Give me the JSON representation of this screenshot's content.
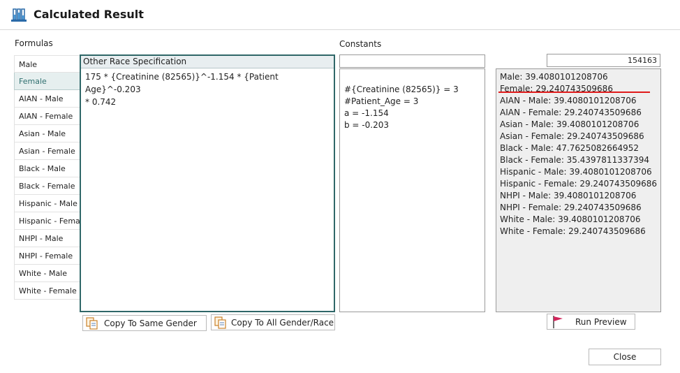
{
  "window": {
    "title": "Calculated Result"
  },
  "formulas": {
    "label": "Formulas",
    "items": [
      "Male",
      "Female",
      "AIAN - Male",
      "AIAN - Female",
      "Asian - Male",
      "Asian - Female",
      "Black - Male",
      "Black - Female",
      "Hispanic - Male",
      "Hispanic - Female",
      "NHPI - Male",
      "NHPI - Female",
      "White - Male",
      "White - Female"
    ],
    "selected": "Female"
  },
  "spec": {
    "header": "Other Race Specification",
    "formula": "175 * {Creatinine (82565)}^-1.154 * {Patient Age}^-0.203\n* 0.742"
  },
  "buttons": {
    "copy_same_gender": "Copy To Same Gender",
    "copy_all": "Copy To All Gender/Race",
    "run_preview": "Run Preview",
    "close": "Close"
  },
  "constants": {
    "label": "Constants",
    "input_value": "",
    "lines": [
      "#{Creatinine (82565)} = 3",
      "#Patient_Age = 3",
      "a = -1.154",
      "b = -0.203"
    ]
  },
  "results": {
    "input_value": "154163",
    "lines": [
      "Male: 39.4080101208706",
      "Female: 29.240743509686",
      "AIAN - Male: 39.4080101208706",
      "AIAN - Female: 29.240743509686",
      "Asian - Male: 39.4080101208706",
      "Asian - Female: 29.240743509686",
      "Black - Male: 47.7625082664952",
      "Black - Female: 35.4397811337394",
      "Hispanic - Male: 39.4080101208706",
      "Hispanic - Female: 29.240743509686",
      "NHPI - Male: 39.4080101208706",
      "NHPI - Female: 29.240743509686",
      "White - Male: 39.4080101208706",
      "White - Female: 29.240743509686"
    ]
  },
  "colors": {
    "accent": "#2f6768",
    "highlight_underline": "#e01b1b",
    "selected_bg": "#e6efef"
  },
  "icons": {
    "title": "lab-tubes-icon",
    "copy": "copy-icon",
    "run": "flag-icon"
  }
}
